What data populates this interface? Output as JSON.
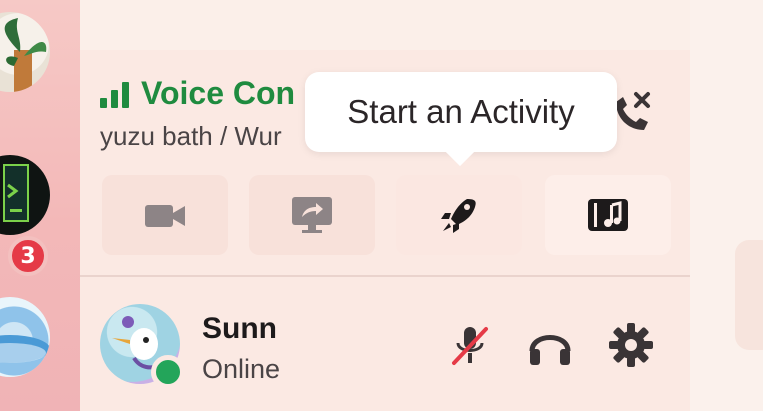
{
  "server_rail": {
    "servers": [
      {
        "name": "plant-server-icon"
      },
      {
        "name": "dark-server-icon"
      },
      {
        "name": "water-server-icon"
      }
    ],
    "badge_count": "3"
  },
  "voice": {
    "status_title": "Voice Con",
    "channel_path": "yuzu bath / Wur",
    "accent": "#1f8b3f"
  },
  "tooltip": {
    "text": "Start an Activity"
  },
  "actions": [
    {
      "name": "camera-icon",
      "state": "disabled"
    },
    {
      "name": "screen-share-icon",
      "state": "disabled"
    },
    {
      "name": "activity-rocket-icon",
      "state": "active"
    },
    {
      "name": "soundboard-icon",
      "state": "active"
    }
  ],
  "user": {
    "name": "Sunn",
    "status": "Online",
    "status_color": "#23a55a",
    "controls": [
      "microphone-muted-icon",
      "headphones-icon",
      "settings-gear-icon"
    ],
    "mute_color": "#e53a47"
  }
}
